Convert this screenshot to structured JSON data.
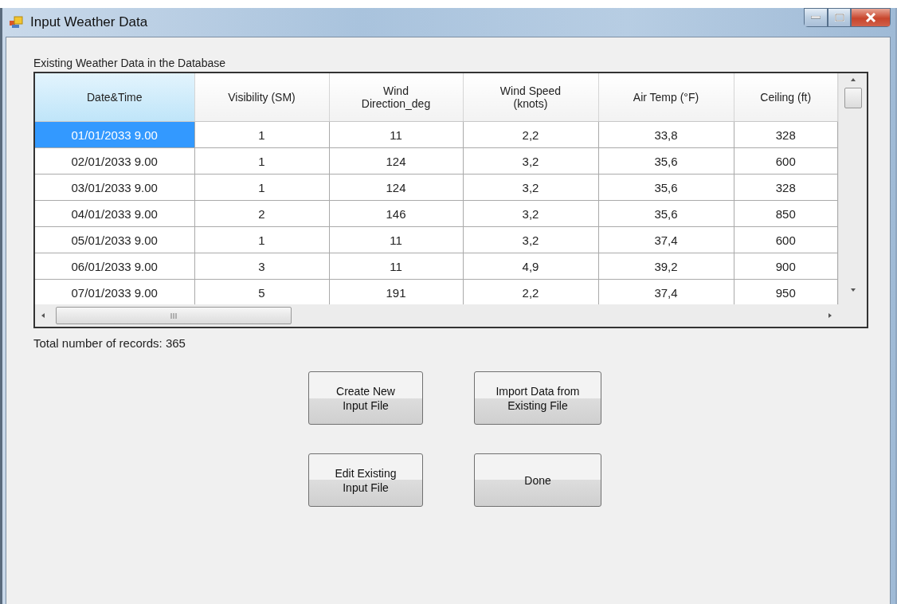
{
  "window": {
    "title": "Input Weather Data"
  },
  "grid_label": "Existing Weather Data in the Database",
  "table": {
    "columns": [
      {
        "label": "Date&Time",
        "selected": true
      },
      {
        "label": "Visibility (SM)",
        "selected": false
      },
      {
        "label": "Wind\nDirection_deg",
        "selected": false
      },
      {
        "label": "Wind Speed\n(knots)",
        "selected": false
      },
      {
        "label": "Air Temp (°F)",
        "selected": false
      },
      {
        "label": "Ceiling (ft)",
        "selected": false
      }
    ],
    "rows": [
      {
        "selected": true,
        "cells": [
          "01/01/2033 9.00",
          "1",
          "11",
          "2,2",
          "33,8",
          "328"
        ]
      },
      {
        "selected": false,
        "cells": [
          "02/01/2033 9.00",
          "1",
          "124",
          "3,2",
          "35,6",
          "600"
        ]
      },
      {
        "selected": false,
        "cells": [
          "03/01/2033 9.00",
          "1",
          "124",
          "3,2",
          "35,6",
          "328"
        ]
      },
      {
        "selected": false,
        "cells": [
          "04/01/2033 9.00",
          "2",
          "146",
          "3,2",
          "35,6",
          "850"
        ]
      },
      {
        "selected": false,
        "cells": [
          "05/01/2033 9.00",
          "1",
          "11",
          "3,2",
          "37,4",
          "600"
        ]
      },
      {
        "selected": false,
        "cells": [
          "06/01/2033 9.00",
          "3",
          "11",
          "4,9",
          "39,2",
          "900"
        ]
      },
      {
        "selected": false,
        "cells": [
          "07/01/2033 9.00",
          "5",
          "191",
          "2,2",
          "37,4",
          "950"
        ]
      }
    ]
  },
  "total_records": "Total number of records: 365",
  "buttons": [
    "Create New\nInput File",
    "Import Data from\nExisting File",
    "Edit Existing\nInput File",
    "Done"
  ]
}
